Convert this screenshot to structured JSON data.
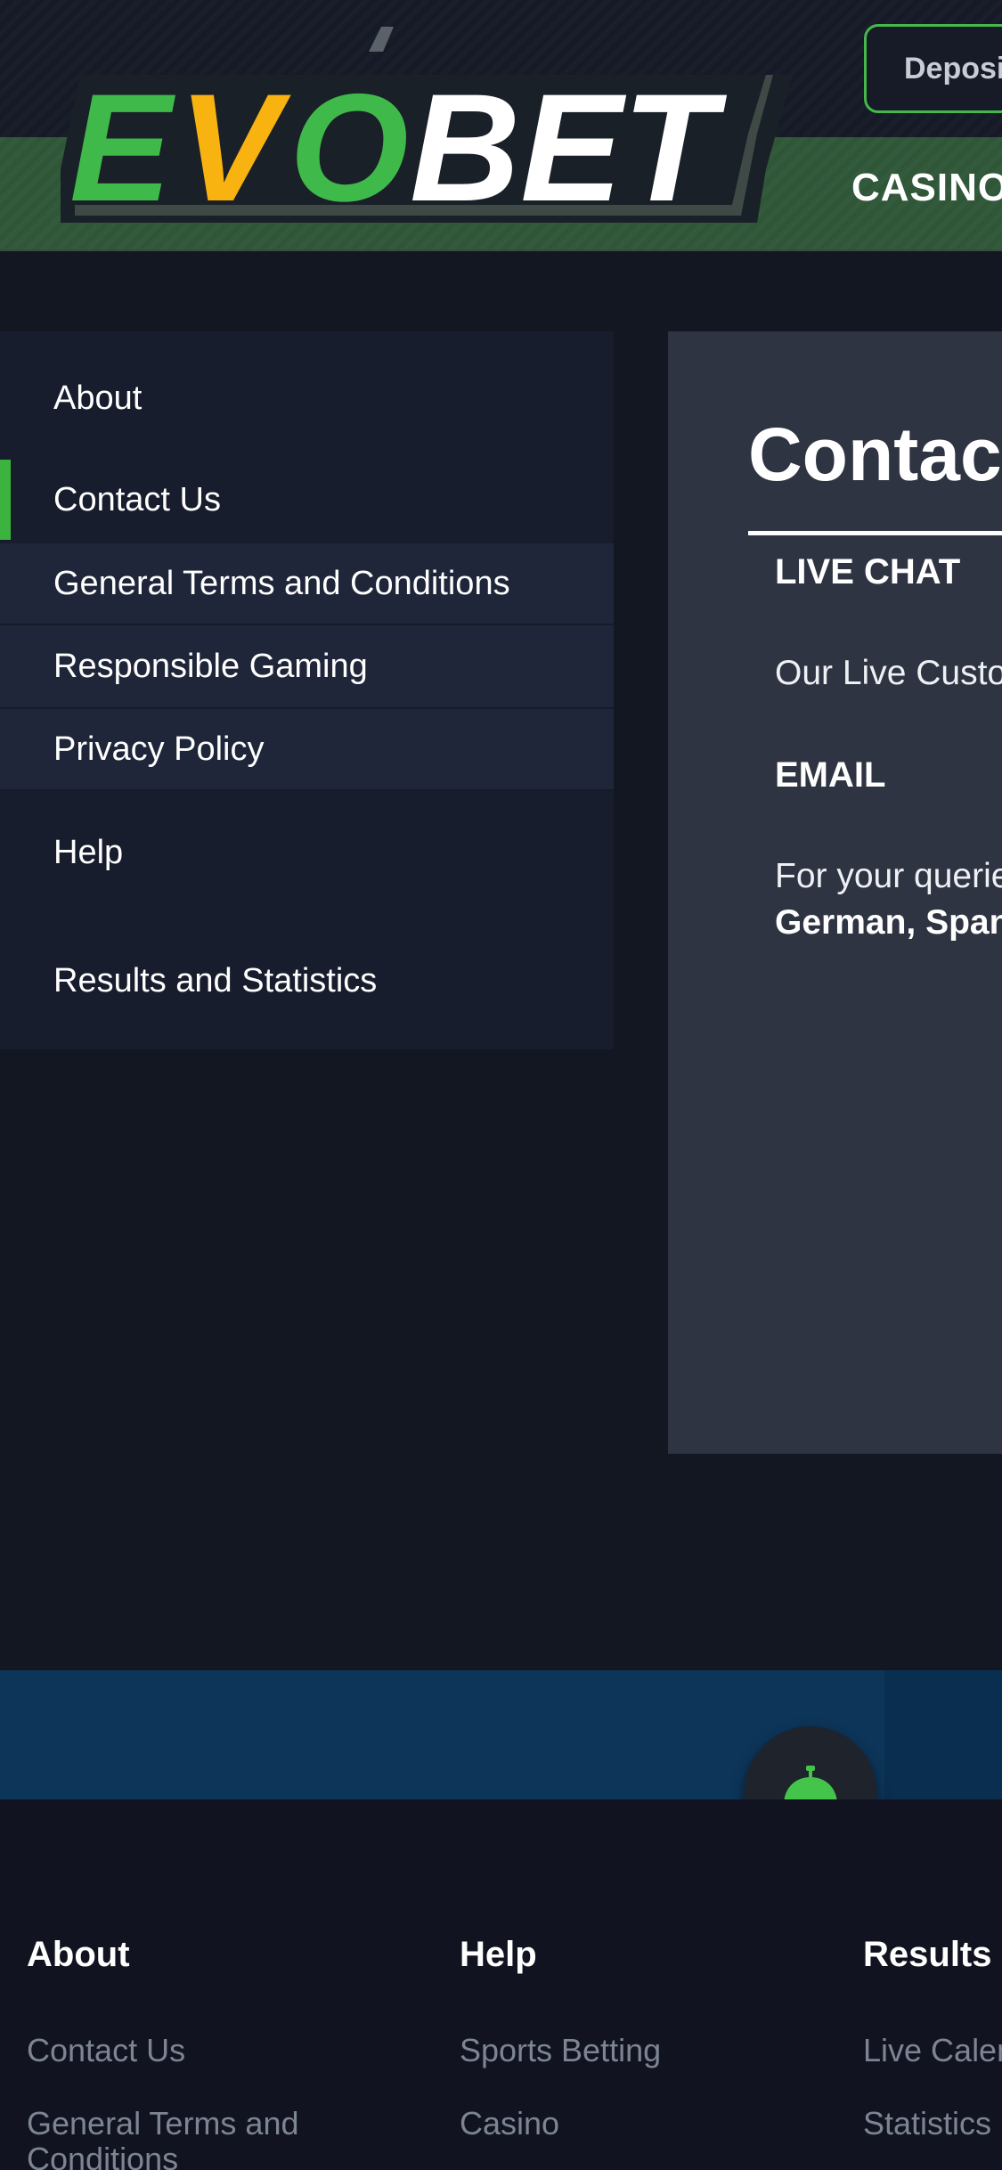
{
  "header": {
    "logo": {
      "text": "EVOBET",
      "parts": {
        "e": "E",
        "v": "V",
        "o": "O",
        "bet": "BET"
      },
      "colors": {
        "green": "#3fb94a",
        "yellow": "#f9b310",
        "white": "#ffffff"
      }
    },
    "deposit_label": "Deposit",
    "nav": {
      "casino_label": "CASINO"
    }
  },
  "sidebar": {
    "items": [
      {
        "label": "About"
      },
      {
        "label": "Contact Us",
        "active": true
      },
      {
        "label": "General Terms and Conditions"
      },
      {
        "label": "Responsible Gaming"
      },
      {
        "label": "Privacy Policy"
      },
      {
        "label": "Help"
      },
      {
        "label": "Results and Statistics"
      }
    ],
    "active_color": "#3cb23f"
  },
  "content": {
    "title": "Contact Us",
    "live_chat_heading": "LIVE CHAT",
    "live_chat_text": "Our Live Customer Support",
    "email_heading": "EMAIL",
    "email_text": "For your queries",
    "languages_text": "German, Spanish"
  },
  "support_button": {
    "icon": "bell-icon",
    "color": "#3cb23f"
  },
  "footer": {
    "columns": [
      {
        "heading": "About",
        "links": [
          "Contact Us",
          "General Terms and Conditions"
        ]
      },
      {
        "heading": "Help",
        "links": [
          "Sports Betting",
          "Casino"
        ]
      },
      {
        "heading": "Results and Statistics",
        "links": [
          "Live Calendar",
          "Statistics"
        ]
      }
    ]
  }
}
